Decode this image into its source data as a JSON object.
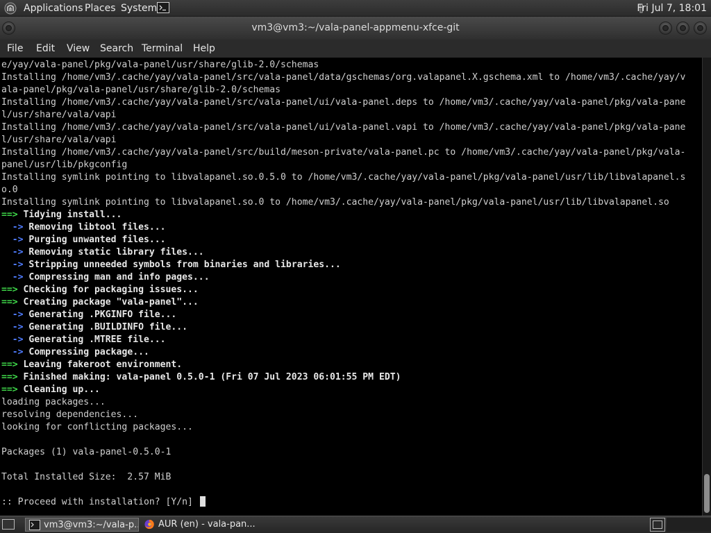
{
  "top_panel": {
    "menus": [
      "Applications",
      "Places",
      "System"
    ],
    "clock": "Fri Jul  7, 18:01"
  },
  "window": {
    "title": "vm3@vm3:~/vala-panel-appmenu-xfce-git"
  },
  "menubar": {
    "items": [
      "File",
      "Edit",
      "View",
      "Search",
      "Terminal",
      "Help"
    ]
  },
  "terminal": {
    "lines": [
      {
        "text": "e/yay/vala-panel/pkg/vala-panel/usr/share/glib-2.0/schemas"
      },
      {
        "text": "Installing /home/vm3/.cache/yay/vala-panel/src/vala-panel/data/gschemas/org.valapanel.X.gschema.xml to /home/vm3/.cache/yay/v"
      },
      {
        "text": "ala-panel/pkg/vala-panel/usr/share/glib-2.0/schemas"
      },
      {
        "text": "Installing /home/vm3/.cache/yay/vala-panel/src/vala-panel/ui/vala-panel.deps to /home/vm3/.cache/yay/vala-panel/pkg/vala-pane"
      },
      {
        "text": "l/usr/share/vala/vapi"
      },
      {
        "text": "Installing /home/vm3/.cache/yay/vala-panel/src/vala-panel/ui/vala-panel.vapi to /home/vm3/.cache/yay/vala-panel/pkg/vala-pane"
      },
      {
        "text": "l/usr/share/vala/vapi"
      },
      {
        "text": "Installing /home/vm3/.cache/yay/vala-panel/src/build/meson-private/vala-panel.pc to /home/vm3/.cache/yay/vala-panel/pkg/vala-"
      },
      {
        "text": "panel/usr/lib/pkgconfig"
      },
      {
        "text": "Installing symlink pointing to libvalapanel.so.0.5.0 to /home/vm3/.cache/yay/vala-panel/pkg/vala-panel/usr/lib/libvalapanel.s"
      },
      {
        "text": "o.0"
      },
      {
        "text": "Installing symlink pointing to libvalapanel.so.0 to /home/vm3/.cache/yay/vala-panel/pkg/vala-panel/usr/lib/libvalapanel.so"
      },
      {
        "prefix": "==>",
        "prefix_color": "green",
        "text": " Tidying install..."
      },
      {
        "prefix": "  ->",
        "prefix_color": "blue",
        "text": " Removing libtool files..."
      },
      {
        "prefix": "  ->",
        "prefix_color": "blue",
        "text": " Purging unwanted files..."
      },
      {
        "prefix": "  ->",
        "prefix_color": "blue",
        "text": " Removing static library files..."
      },
      {
        "prefix": "  ->",
        "prefix_color": "blue",
        "text": " Stripping unneeded symbols from binaries and libraries..."
      },
      {
        "prefix": "  ->",
        "prefix_color": "blue",
        "text": " Compressing man and info pages..."
      },
      {
        "prefix": "==>",
        "prefix_color": "green",
        "text": " Checking for packaging issues..."
      },
      {
        "prefix": "==>",
        "prefix_color": "green",
        "text": " Creating package \"vala-panel\"..."
      },
      {
        "prefix": "  ->",
        "prefix_color": "blue",
        "text": " Generating .PKGINFO file..."
      },
      {
        "prefix": "  ->",
        "prefix_color": "blue",
        "text": " Generating .BUILDINFO file..."
      },
      {
        "prefix": "  ->",
        "prefix_color": "blue",
        "text": " Generating .MTREE file..."
      },
      {
        "prefix": "  ->",
        "prefix_color": "blue",
        "text": " Compressing package..."
      },
      {
        "prefix": "==>",
        "prefix_color": "green",
        "text": " Leaving fakeroot environment."
      },
      {
        "prefix": "==>",
        "prefix_color": "green",
        "text": " Finished making: vala-panel 0.5.0-1 (Fri 07 Jul 2023 06:01:55 PM EDT)"
      },
      {
        "prefix": "==>",
        "prefix_color": "green",
        "text": " Cleaning up..."
      },
      {
        "text": "loading packages..."
      },
      {
        "text": "resolving dependencies..."
      },
      {
        "text": "looking for conflicting packages..."
      },
      {
        "text": ""
      },
      {
        "text": "Packages (1) vala-panel-0.5.0-1"
      },
      {
        "text": ""
      },
      {
        "text": "Total Installed Size:  2.57 MiB"
      },
      {
        "text": ""
      },
      {
        "text": ":: Proceed with installation? [Y/n] ",
        "cursor": true
      }
    ]
  },
  "taskbar": {
    "tasks": [
      {
        "label": "vm3@vm3:~/vala-p...",
        "icon": "terminal-icon",
        "active": true
      },
      {
        "label": "AUR (en) - vala-pan...",
        "icon": "firefox-icon",
        "active": false
      }
    ]
  },
  "colors": {
    "prompt_green": "#3fd94a",
    "arrow_blue": "#4f7cff",
    "terminal_bg": "#000000",
    "panel_bg": "#333333"
  }
}
